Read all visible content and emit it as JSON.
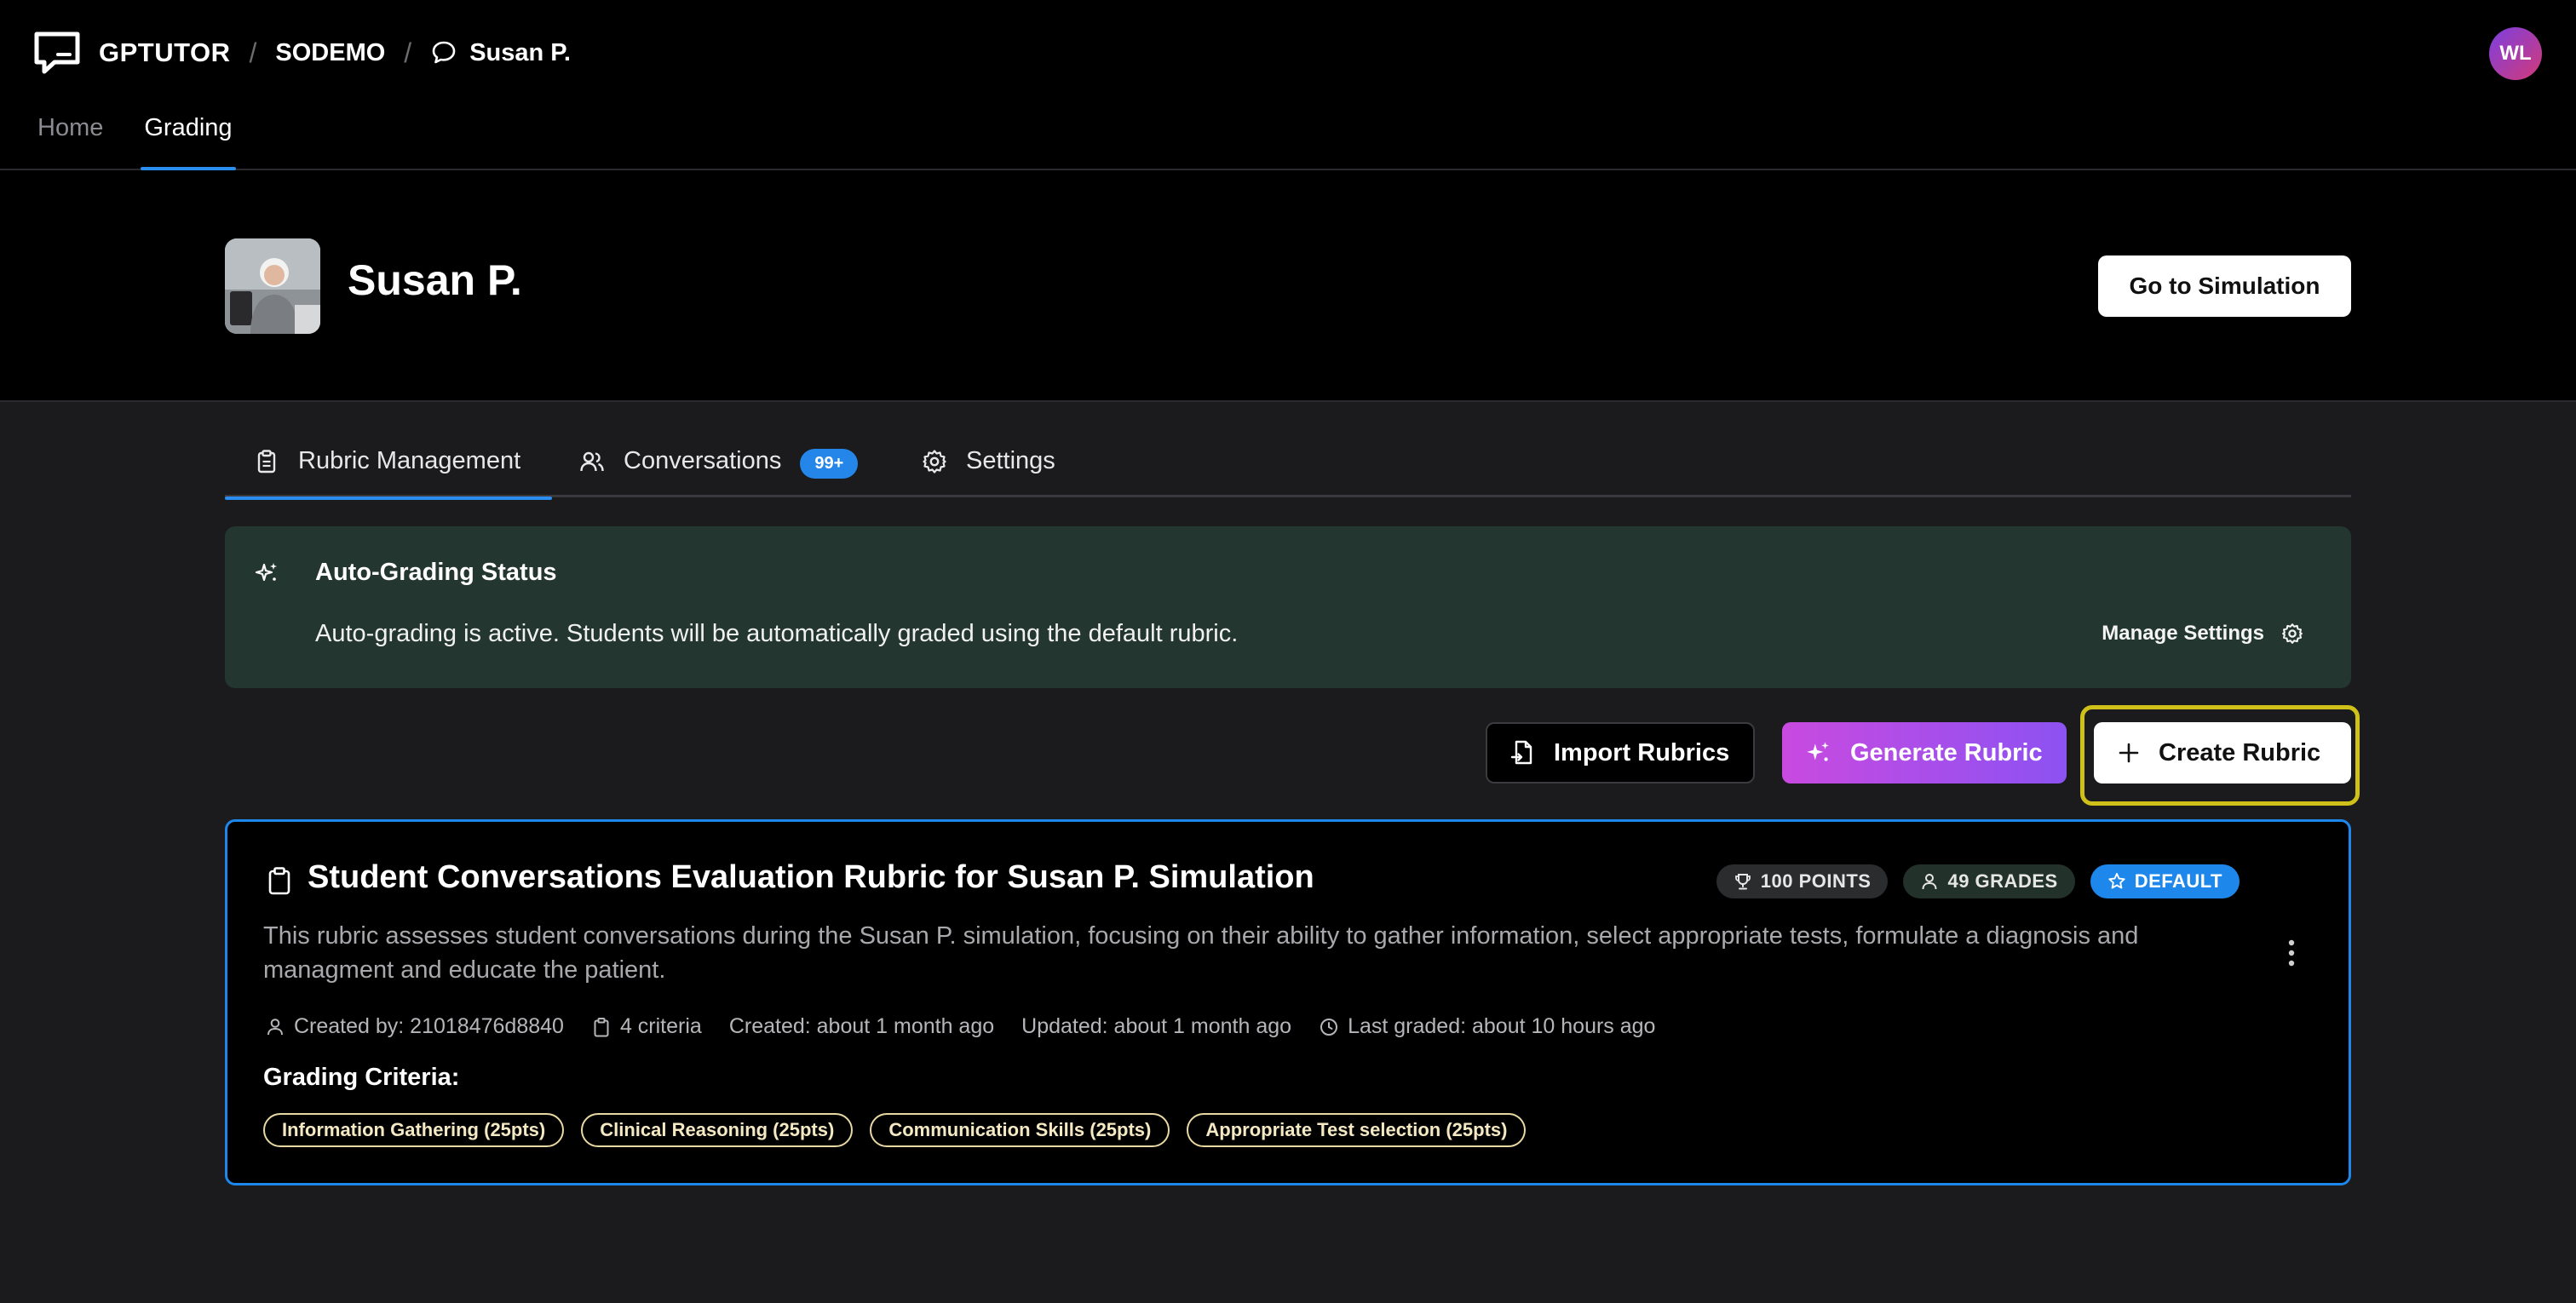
{
  "header": {
    "brand": "GPTUTOR",
    "breadcrumb": [
      "SODEMO",
      "Susan P."
    ],
    "user_initials": "WL",
    "nav_tabs": [
      {
        "label": "Home",
        "active": false
      },
      {
        "label": "Grading",
        "active": true
      }
    ]
  },
  "hero": {
    "title": "Susan P.",
    "goto_button": "Go to Simulation"
  },
  "tabs": [
    {
      "label": "Rubric Management",
      "icon": "clipboard-icon",
      "active": true
    },
    {
      "label": "Conversations",
      "icon": "users-icon",
      "badge": "99+"
    },
    {
      "label": "Settings",
      "icon": "gear-icon"
    }
  ],
  "auto_grading": {
    "title": "Auto-Grading Status",
    "description": "Auto-grading is active. Students will be automatically graded using the default rubric.",
    "manage_link": "Manage Settings"
  },
  "actions": {
    "import": "Import Rubrics",
    "generate": "Generate Rubric",
    "create": "Create Rubric"
  },
  "rubric": {
    "title": "Student Conversations Evaluation Rubric for Susan P. Simulation",
    "chips": {
      "points": "100 POINTS",
      "grades": "49 GRADES",
      "default": "DEFAULT"
    },
    "description": "This rubric assesses student conversations during the Susan P. simulation, focusing on their ability to gather information, select appropriate tests, formulate a diagnosis and managment and educate the patient.",
    "meta": {
      "created_by": "Created by: 21018476d8840",
      "criteria_count": "4 criteria",
      "created": "Created: about 1 month ago",
      "updated": "Updated: about 1 month ago",
      "last_graded": "Last graded: about 10 hours ago"
    },
    "criteria_heading": "Grading Criteria:",
    "criteria": [
      "Information Gathering (25pts)",
      "Clinical Reasoning (25pts)",
      "Communication Skills (25pts)",
      "Appropriate Test selection (25pts)"
    ]
  },
  "colors": {
    "accent": "#1e87ec",
    "auto_panel_bg": "#233630",
    "generate_gradient": [
      "#c94ae0",
      "#8c52f2"
    ],
    "focus_ring": "#cfc01a",
    "criteria_border": "#e8d8a4"
  }
}
